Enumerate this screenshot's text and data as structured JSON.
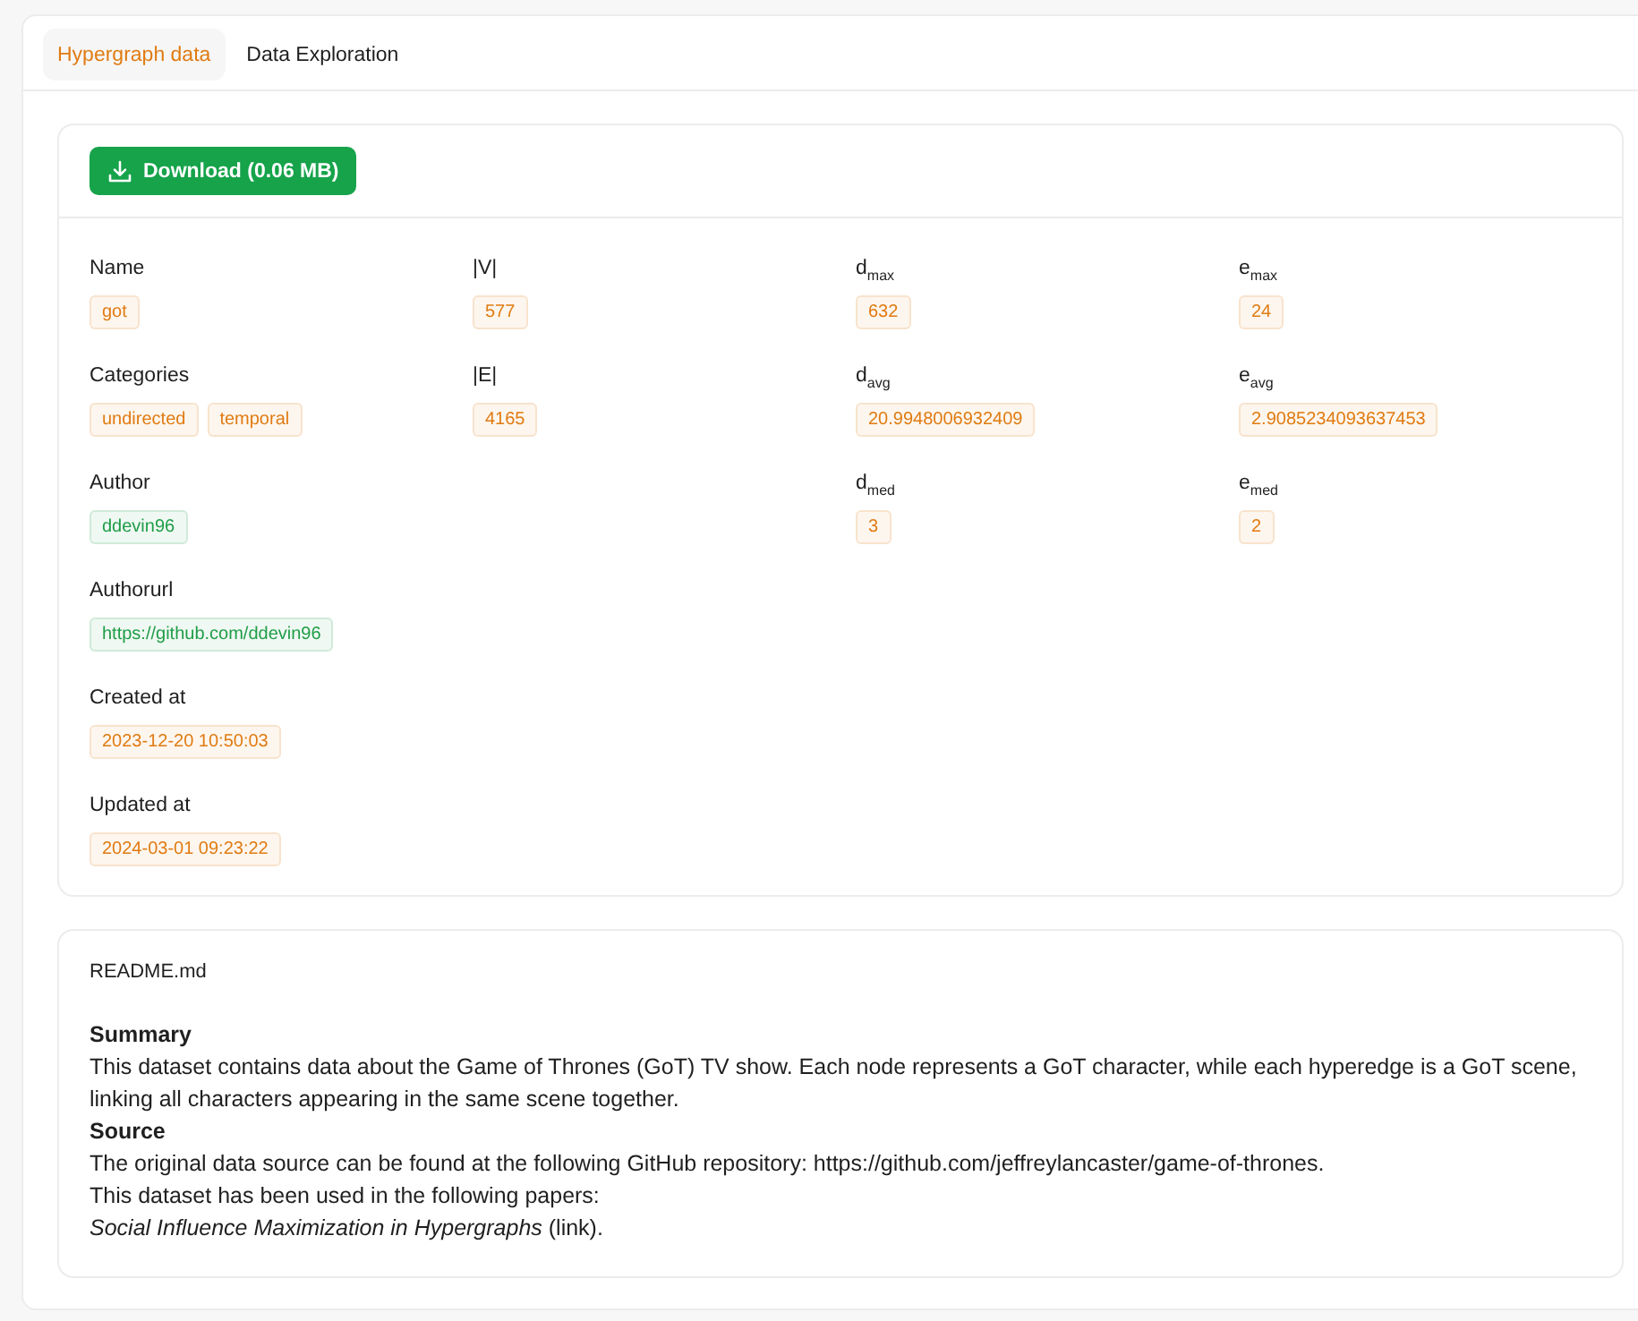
{
  "tabs": [
    {
      "label": "Hypergraph data",
      "selected": true
    },
    {
      "label": "Data Exploration",
      "selected": false
    }
  ],
  "download_button": {
    "label": "Download (0.06 MB)"
  },
  "columns": [
    [
      {
        "label": "Name",
        "tags": [
          {
            "text": "got",
            "color": "#e07b12"
          }
        ]
      },
      {
        "label": "Categories",
        "tags": [
          {
            "text": "undirected",
            "color": "#e07b12"
          },
          {
            "text": "temporal",
            "color": "#e07b12"
          }
        ]
      },
      {
        "label": "Author",
        "tags": [
          {
            "text": "ddevin96",
            "color": "#1f9d48"
          }
        ]
      },
      {
        "label": "Authorurl",
        "tags": [
          {
            "text": "https://github.com/ddevin96",
            "color": "#1f9d48"
          }
        ]
      },
      {
        "label": "Created at",
        "tags": [
          {
            "text": "2023-12-20 10:50:03",
            "color": "#e07b12"
          }
        ]
      },
      {
        "label": "Updated at",
        "tags": [
          {
            "text": "2024-03-01 09:23:22",
            "color": "#e07b12"
          }
        ]
      }
    ],
    [
      {
        "label": "|V|",
        "tags": [
          {
            "text": "577",
            "color": "#e07b12"
          }
        ]
      },
      {
        "label": "|E|",
        "tags": [
          {
            "text": "4165",
            "color": "#e07b12"
          }
        ]
      }
    ],
    [
      {
        "label": "d$_{max}$",
        "tags": [
          {
            "text": "632",
            "color": "#e07b12"
          }
        ]
      },
      {
        "label": "d$_{avg}$",
        "tags": [
          {
            "text": "20.9948006932409",
            "color": "#e07b12"
          }
        ]
      },
      {
        "label": "d$_{med}$",
        "tags": [
          {
            "text": "3",
            "color": "#e07b12"
          }
        ]
      }
    ],
    [
      {
        "label": "e$_{max}$",
        "tags": [
          {
            "text": "24",
            "color": "#e07b12"
          }
        ]
      },
      {
        "label": "e$_{avg}$",
        "tags": [
          {
            "text": "2.9085234093637453",
            "color": "#e07b12"
          }
        ]
      },
      {
        "label": "e$_{med}$",
        "tags": [
          {
            "text": "2",
            "color": "#e07b12"
          }
        ]
      }
    ]
  ],
  "readme": {
    "title": "README.md",
    "blocks": [
      {
        "kind": "heading",
        "text": "Summary"
      },
      {
        "kind": "paragraph",
        "text": "This dataset contains data about the Game of Thrones (GoT) TV show. Each node represents a GoT character, while each hyperedge is a GoT scene, linking all characters appearing in the same scene together."
      },
      {
        "kind": "heading",
        "text": "Source"
      },
      {
        "kind": "paragraph",
        "text": "The original data source can be found at the following GitHub repository: https://github.com/jeffreylancaster/game-of-thrones."
      },
      {
        "kind": "paragraph",
        "text": "This dataset has been used in the following papers:"
      },
      {
        "kind": "paragraph",
        "text": "*Social Influence Maximization in Hypergraphs* (link)."
      }
    ]
  }
}
